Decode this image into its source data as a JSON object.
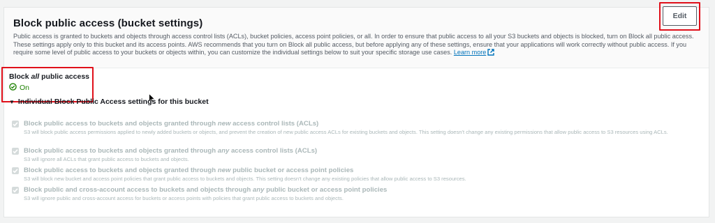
{
  "panel": {
    "title": "Block public access (bucket settings)",
    "description": "Public access is granted to buckets and objects through access control lists (ACLs), bucket policies, access point policies, or all. In order to ensure that public access to all your S3 buckets and objects is blocked, turn on Block all public access. These settings apply only to this bucket and its access points. AWS recommends that you turn on Block all public access, but before applying any of these settings, ensure that your applications will work correctly without public access. If you require some level of public access to your buckets or objects within, you can customize the individual settings below to suit your specific storage use cases.",
    "learn_more": "Learn more",
    "edit_label": "Edit"
  },
  "block_all": {
    "label_prefix": "Block",
    "label_emph": "all",
    "label_suffix": "public access",
    "status": "On",
    "status_color": "#1d8102"
  },
  "section": {
    "toggle_label": "Individual Block Public Access settings for this bucket"
  },
  "settings": [
    {
      "title_prefix": "Block public access to buckets and objects granted through",
      "title_emph": "new",
      "title_suffix": "access control lists (ACLs)",
      "description": "S3 will block public access permissions applied to newly added buckets or objects, and prevent the creation of new public access ACLs for existing buckets and objects. This setting doesn't change any existing permissions that allow public access to S3 resources using ACLs.",
      "checked": true
    },
    {
      "title_prefix": "Block public access to buckets and objects granted through",
      "title_emph": "any",
      "title_suffix": "access control lists (ACLs)",
      "description": "S3 will ignore all ACLs that grant public access to buckets and objects.",
      "checked": true
    },
    {
      "title_prefix": "Block public access to buckets and objects granted through",
      "title_emph": "new",
      "title_suffix": "public bucket or access point policies",
      "description": "S3 will block new bucket and access point policies that grant public access to buckets and objects. This setting doesn't change any existing policies that allow public access to S3 resources.",
      "checked": true
    },
    {
      "title_prefix": "Block public and cross-account access to buckets and objects through",
      "title_emph": "any",
      "title_suffix": "public bucket or access point policies",
      "description": "S3 will ignore public and cross-account access for buckets or access points with policies that grant public access to buckets and objects.",
      "checked": true
    }
  ],
  "colors": {
    "accent_link": "#0073bb",
    "highlight_outline": "#e0101a",
    "disabled_text": "#aab7b8"
  }
}
